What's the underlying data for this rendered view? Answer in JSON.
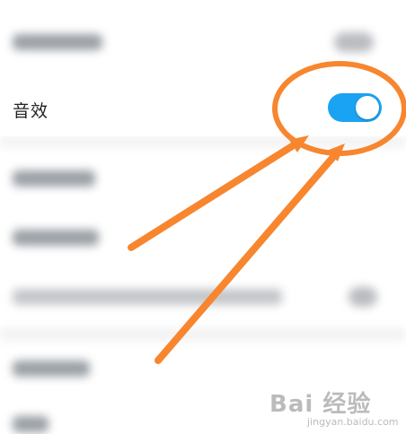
{
  "settings": {
    "sound_effect": {
      "label": "音效",
      "enabled": true
    }
  },
  "colors": {
    "toggle_on": "#1aa3f2",
    "annotation": "#f7862f"
  },
  "watermark": {
    "logo": "Bai 经验",
    "url": "jingyan.baidu.com"
  }
}
